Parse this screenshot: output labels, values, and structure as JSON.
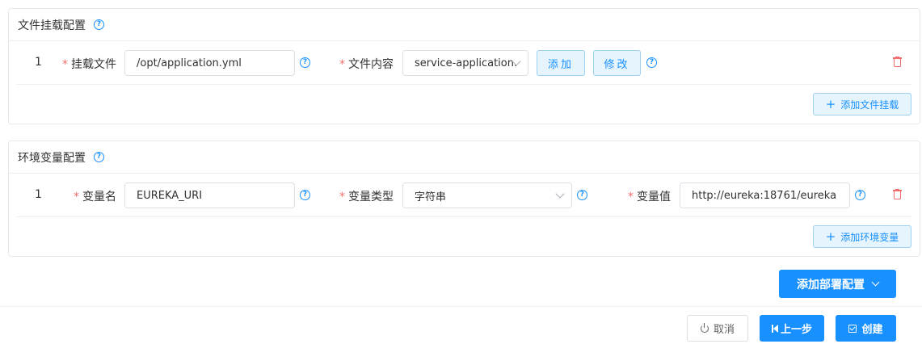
{
  "file_mount": {
    "title": "文件挂载配置",
    "row": {
      "index": "1",
      "mount_file_label": "挂载文件",
      "mount_file_value": "/opt/application.yml",
      "content_label": "文件内容",
      "content_value": "service-application.",
      "add_button": "添加",
      "edit_button": "修改"
    },
    "add_button": "添加文件挂载"
  },
  "env_vars": {
    "title": "环境变量配置",
    "row": {
      "index": "1",
      "name_label": "变量名",
      "name_value": "EUREKA_URI",
      "type_label": "变量类型",
      "type_value": "字符串",
      "value_label": "变量值",
      "value_value": "http://eureka:18761/eureka"
    },
    "add_button": "添加环境变量"
  },
  "add_deploy_config": "添加部署配置",
  "footer": {
    "cancel": "取消",
    "prev": "上一步",
    "create": "创建"
  },
  "colors": {
    "primary": "#1890ff",
    "required": "#f56c6c",
    "light_button_bg": "#e6f4fd"
  }
}
